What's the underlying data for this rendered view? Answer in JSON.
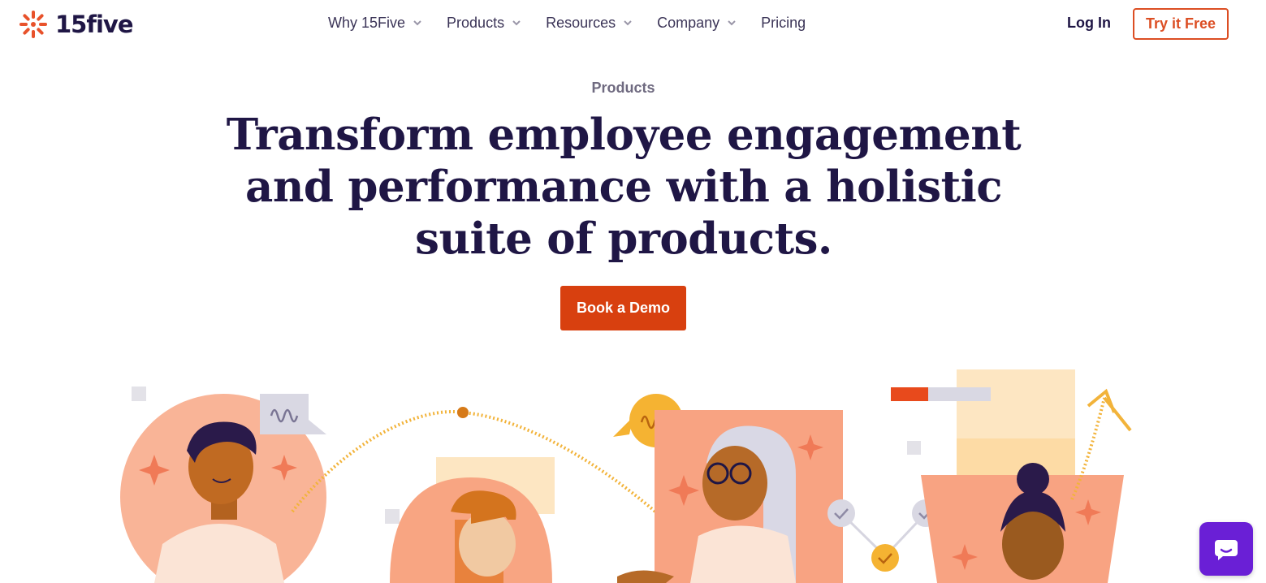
{
  "brand": {
    "name": "15five",
    "logo_icon": "burst-logo-icon",
    "accent": "#dc4e23",
    "ink": "#1f1645"
  },
  "nav": {
    "items": [
      {
        "label": "Why 15Five",
        "has_dropdown": true
      },
      {
        "label": "Products",
        "has_dropdown": true
      },
      {
        "label": "Resources",
        "has_dropdown": true
      },
      {
        "label": "Company",
        "has_dropdown": true
      },
      {
        "label": "Pricing",
        "has_dropdown": false
      }
    ],
    "login_label": "Log In",
    "try_label": "Try it Free"
  },
  "hero": {
    "eyebrow": "Products",
    "headline": "Transform employee engagement and performance with a holistic suite of products.",
    "cta_label": "Book a Demo",
    "cta_color": "#d8400f"
  },
  "chat": {
    "icon": "chat-bubble-icon",
    "color": "#6a1fd6"
  }
}
